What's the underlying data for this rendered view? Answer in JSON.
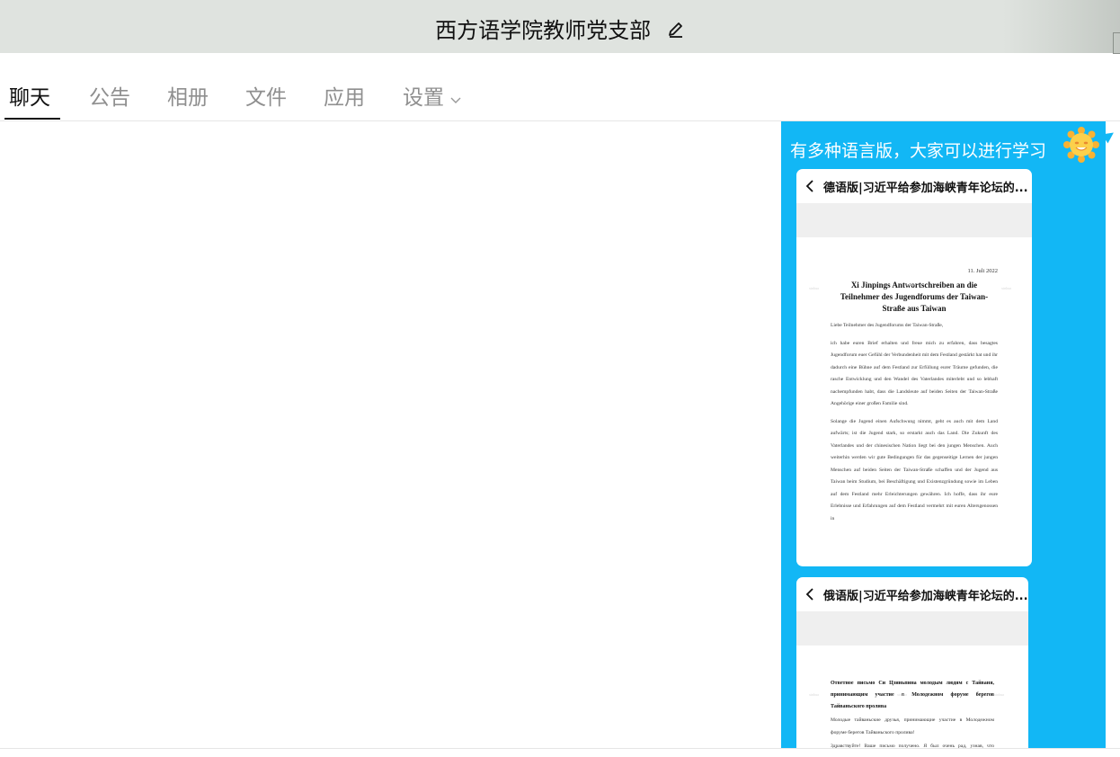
{
  "window": {
    "title": "西方语学院教师党支部"
  },
  "tabs": [
    {
      "label": "聊天",
      "active": true
    },
    {
      "label": "公告"
    },
    {
      "label": "相册"
    },
    {
      "label": "文件"
    },
    {
      "label": "应用"
    },
    {
      "label": "设置"
    }
  ],
  "message": {
    "text": "有多种语言版，大家可以进行学习",
    "bubble_color": "#12b7f5",
    "cards": [
      {
        "title": "德语版|习近平给参加海峡青年论坛的...",
        "date": "11. Juli 2022",
        "heading": "Xi Jinpings Antwortschreiben an die Teilnehmer des Jugendforums der Taiwan-Straße aus Taiwan",
        "p1": "Liebe Teilnehmer des Jugendforums der Taiwan-Straße,",
        "p2": "ich habe euren Brief erhalten und freue mich zu erfahren, dass besagtes Jugendforum euer Gefühl der Verbundenheit mit dem Festland gestärkt hat und ihr dadurch eine Bühne auf dem Festland zur Erfüllung eurer Träume gefunden, die rasche Entwicklung und den Wandel des Vaterlandes miterlebt und so lebhaft nachempfunden habt, dass die Landsleute auf beiden Seiten der Taiwan-Straße Angehörige einer großen Familie sind.",
        "p3": "Solange die Jugend einen Aufschwung nimmt, geht es auch mit dem Land aufwärts; ist die Jugend stark, so erstarkt auch das Land. Die Zukunft des Vaterlandes und der chinesischen Nation liegt bei den jungen Menschen. Auch weiterhin werden wir gute Bedingungen für das gegenseitige Lernen der jungen Menschen auf beiden Seiten der Taiwan-Straße schaffen und der Jugend aus Taiwan beim Studium, bei Beschäftigung und Existenzgründung sowie im Leben auf dem Festland mehr Erleichterungen gewähren. Ich hoffe, dass ihr eure Erlebnisse und Erfahrungen auf dem Festland vermehrt mit euren Altersgenossen in"
      },
      {
        "title": "俄语版|习近平给参加海峡青年论坛的...",
        "heading": "Ответное письмо Си Цзиньпина молодым людям с Тайваня, принимающим участие в Молодежном форуме берегов Тайваньского пролива",
        "p1": "Молодые тайваньские друзья, принимающие участие в Молодежном форуме берегов Тайваньского пролива!",
        "p2": "Здравствуйте! Ваше письмо получено. Я был очень рад, узнав, что благодаря Молодежному форуму берегов Тайваньского пролива"
      }
    ]
  }
}
